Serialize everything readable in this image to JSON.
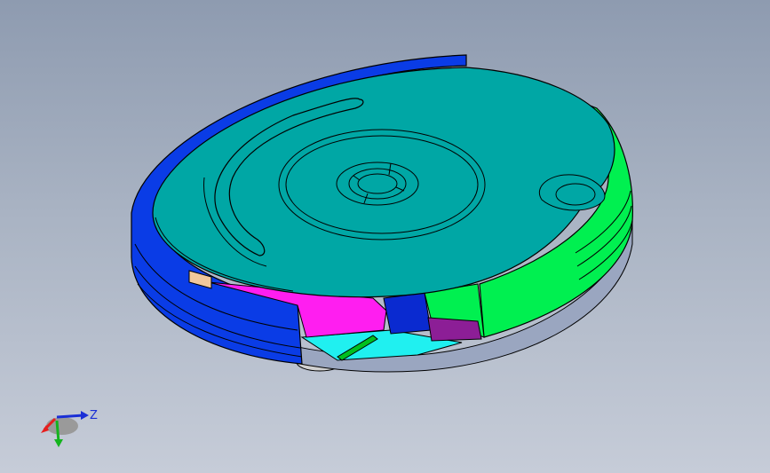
{
  "viewport": {
    "background_top": "#8e9bb0",
    "background_bottom": "#c6ccd8"
  },
  "model": {
    "colors": {
      "top_cover": "#00a7a5",
      "left_bumper": "#0a3ce6",
      "right_bumper": "#00f050",
      "magenta_part": "#ff1ef0",
      "purple_part": "#8c1e96",
      "cyan_part": "#20f0f0",
      "orange_part": "#f0c89c",
      "outline": "#000000"
    }
  },
  "triad": {
    "z_label": "Z",
    "x_color": "#e61e1e",
    "y_color": "#14b41e",
    "z_color": "#1a2fd6"
  }
}
